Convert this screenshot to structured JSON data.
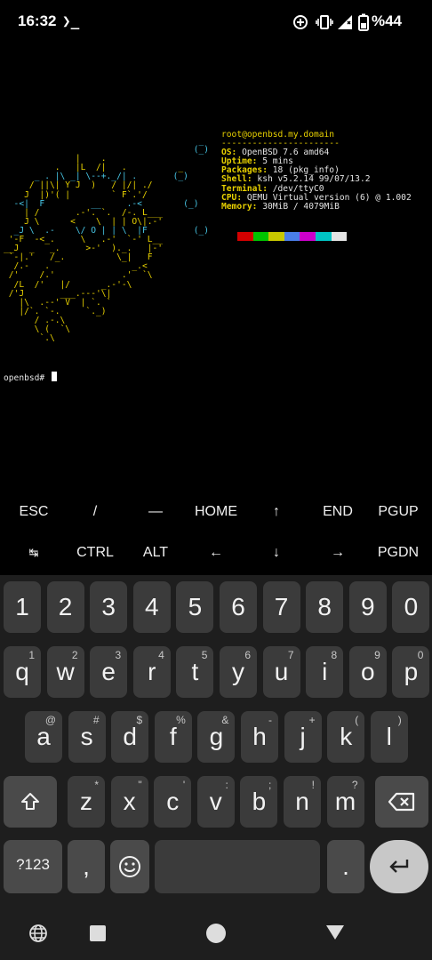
{
  "status": {
    "time": "16:32",
    "terminal_indicator": "❯_",
    "battery_text": "%44",
    "icons": [
      "data-saver-icon",
      "vibrate-icon",
      "signal-icon",
      "battery-icon"
    ]
  },
  "terminal": {
    "logo_lines": [
      "                                      _",
      "                                     (_)",
      "              |    .",
      "          .   |L  /|   .          _",
      "      _ . |\\ _| \\--+._/| .       (_)",
      "     / ||\\| Y J  )   / |/| ./",
      "    J  |)'( |        ` F`.'/",
      "  -<|  F         __     .-<        (_)",
      "    | /       .-'. `.  /-. L___",
      "    J \\      <    \\  | | O\\|.-'",
      "  _J \\  .-    \\/ O | | \\  |F         (_)",
      " '-F  -<_.     \\   .-'  `-' L__",
      "__J  _   _.     >-'  )._.   |-'",
      " `-|.'   /_.          \\_|   F",
      "  /.-   .                _.<",
      " /'    /.'             .'  `\\",
      "  /L  /'   |/      _.-'-\\",
      " /'J       ___.---'\\|",
      "   |\\  .--' V  | `. `",
      "   |/`. `-.     `._)",
      "      / .-.\\",
      "      \\ (  `\\",
      "       `.\\"
    ],
    "info_lines": [
      {
        "key": "root@openbsd.my.domain",
        "value": ""
      },
      {
        "key": "-----------------------",
        "value": ""
      },
      {
        "key": "OS:",
        "value": " OpenBSD 7.6 amd64"
      },
      {
        "key": "Uptime:",
        "value": " 5 mins"
      },
      {
        "key": "Packages:",
        "value": " 18 (pkg_info)"
      },
      {
        "key": "Shell:",
        "value": " ksh v5.2.14 99/07/13.2"
      },
      {
        "key": "Terminal:",
        "value": " /dev/ttyC0"
      },
      {
        "key": "CPU:",
        "value": " QEMU Virtual version (6) @ 1.002"
      },
      {
        "key": "Memory:",
        "value": " 30MiB / 4079MiB"
      }
    ],
    "palette": [
      "#d40000",
      "#00c400",
      "#c8c800",
      "#4a7ee8",
      "#cc00cc",
      "#00c4c4",
      "#e4e4e4"
    ],
    "prompt": "openbsd# "
  },
  "extra_keys": {
    "row1": [
      "ESC",
      "/",
      "—",
      "HOME",
      "↑",
      "END",
      "PGUP"
    ],
    "row2": [
      "↹",
      "CTRL",
      "ALT",
      "←",
      "↓",
      "→",
      "PGDN"
    ]
  },
  "keyboard": {
    "numbers": [
      "1",
      "2",
      "3",
      "4",
      "5",
      "6",
      "7",
      "8",
      "9",
      "0"
    ],
    "row_q": [
      {
        "k": "q",
        "h": "1"
      },
      {
        "k": "w",
        "h": "2"
      },
      {
        "k": "e",
        "h": "3"
      },
      {
        "k": "r",
        "h": "4"
      },
      {
        "k": "t",
        "h": "5"
      },
      {
        "k": "y",
        "h": "6"
      },
      {
        "k": "u",
        "h": "7"
      },
      {
        "k": "i",
        "h": "8"
      },
      {
        "k": "o",
        "h": "9"
      },
      {
        "k": "p",
        "h": "0"
      }
    ],
    "row_a": [
      {
        "k": "a",
        "h": "@"
      },
      {
        "k": "s",
        "h": "#"
      },
      {
        "k": "d",
        "h": "$"
      },
      {
        "k": "f",
        "h": "%"
      },
      {
        "k": "g",
        "h": "&"
      },
      {
        "k": "h",
        "h": "-"
      },
      {
        "k": "j",
        "h": "+"
      },
      {
        "k": "k",
        "h": "("
      },
      {
        "k": "l",
        "h": ")"
      }
    ],
    "row_z": [
      {
        "k": "z",
        "h": "*"
      },
      {
        "k": "x",
        "h": "\""
      },
      {
        "k": "c",
        "h": "'"
      },
      {
        "k": "v",
        "h": ":"
      },
      {
        "k": "b",
        "h": ";"
      },
      {
        "k": "n",
        "h": "!"
      },
      {
        "k": "m",
        "h": "?"
      }
    ],
    "symbols_label": "?123",
    "comma": ",",
    "period": "."
  }
}
